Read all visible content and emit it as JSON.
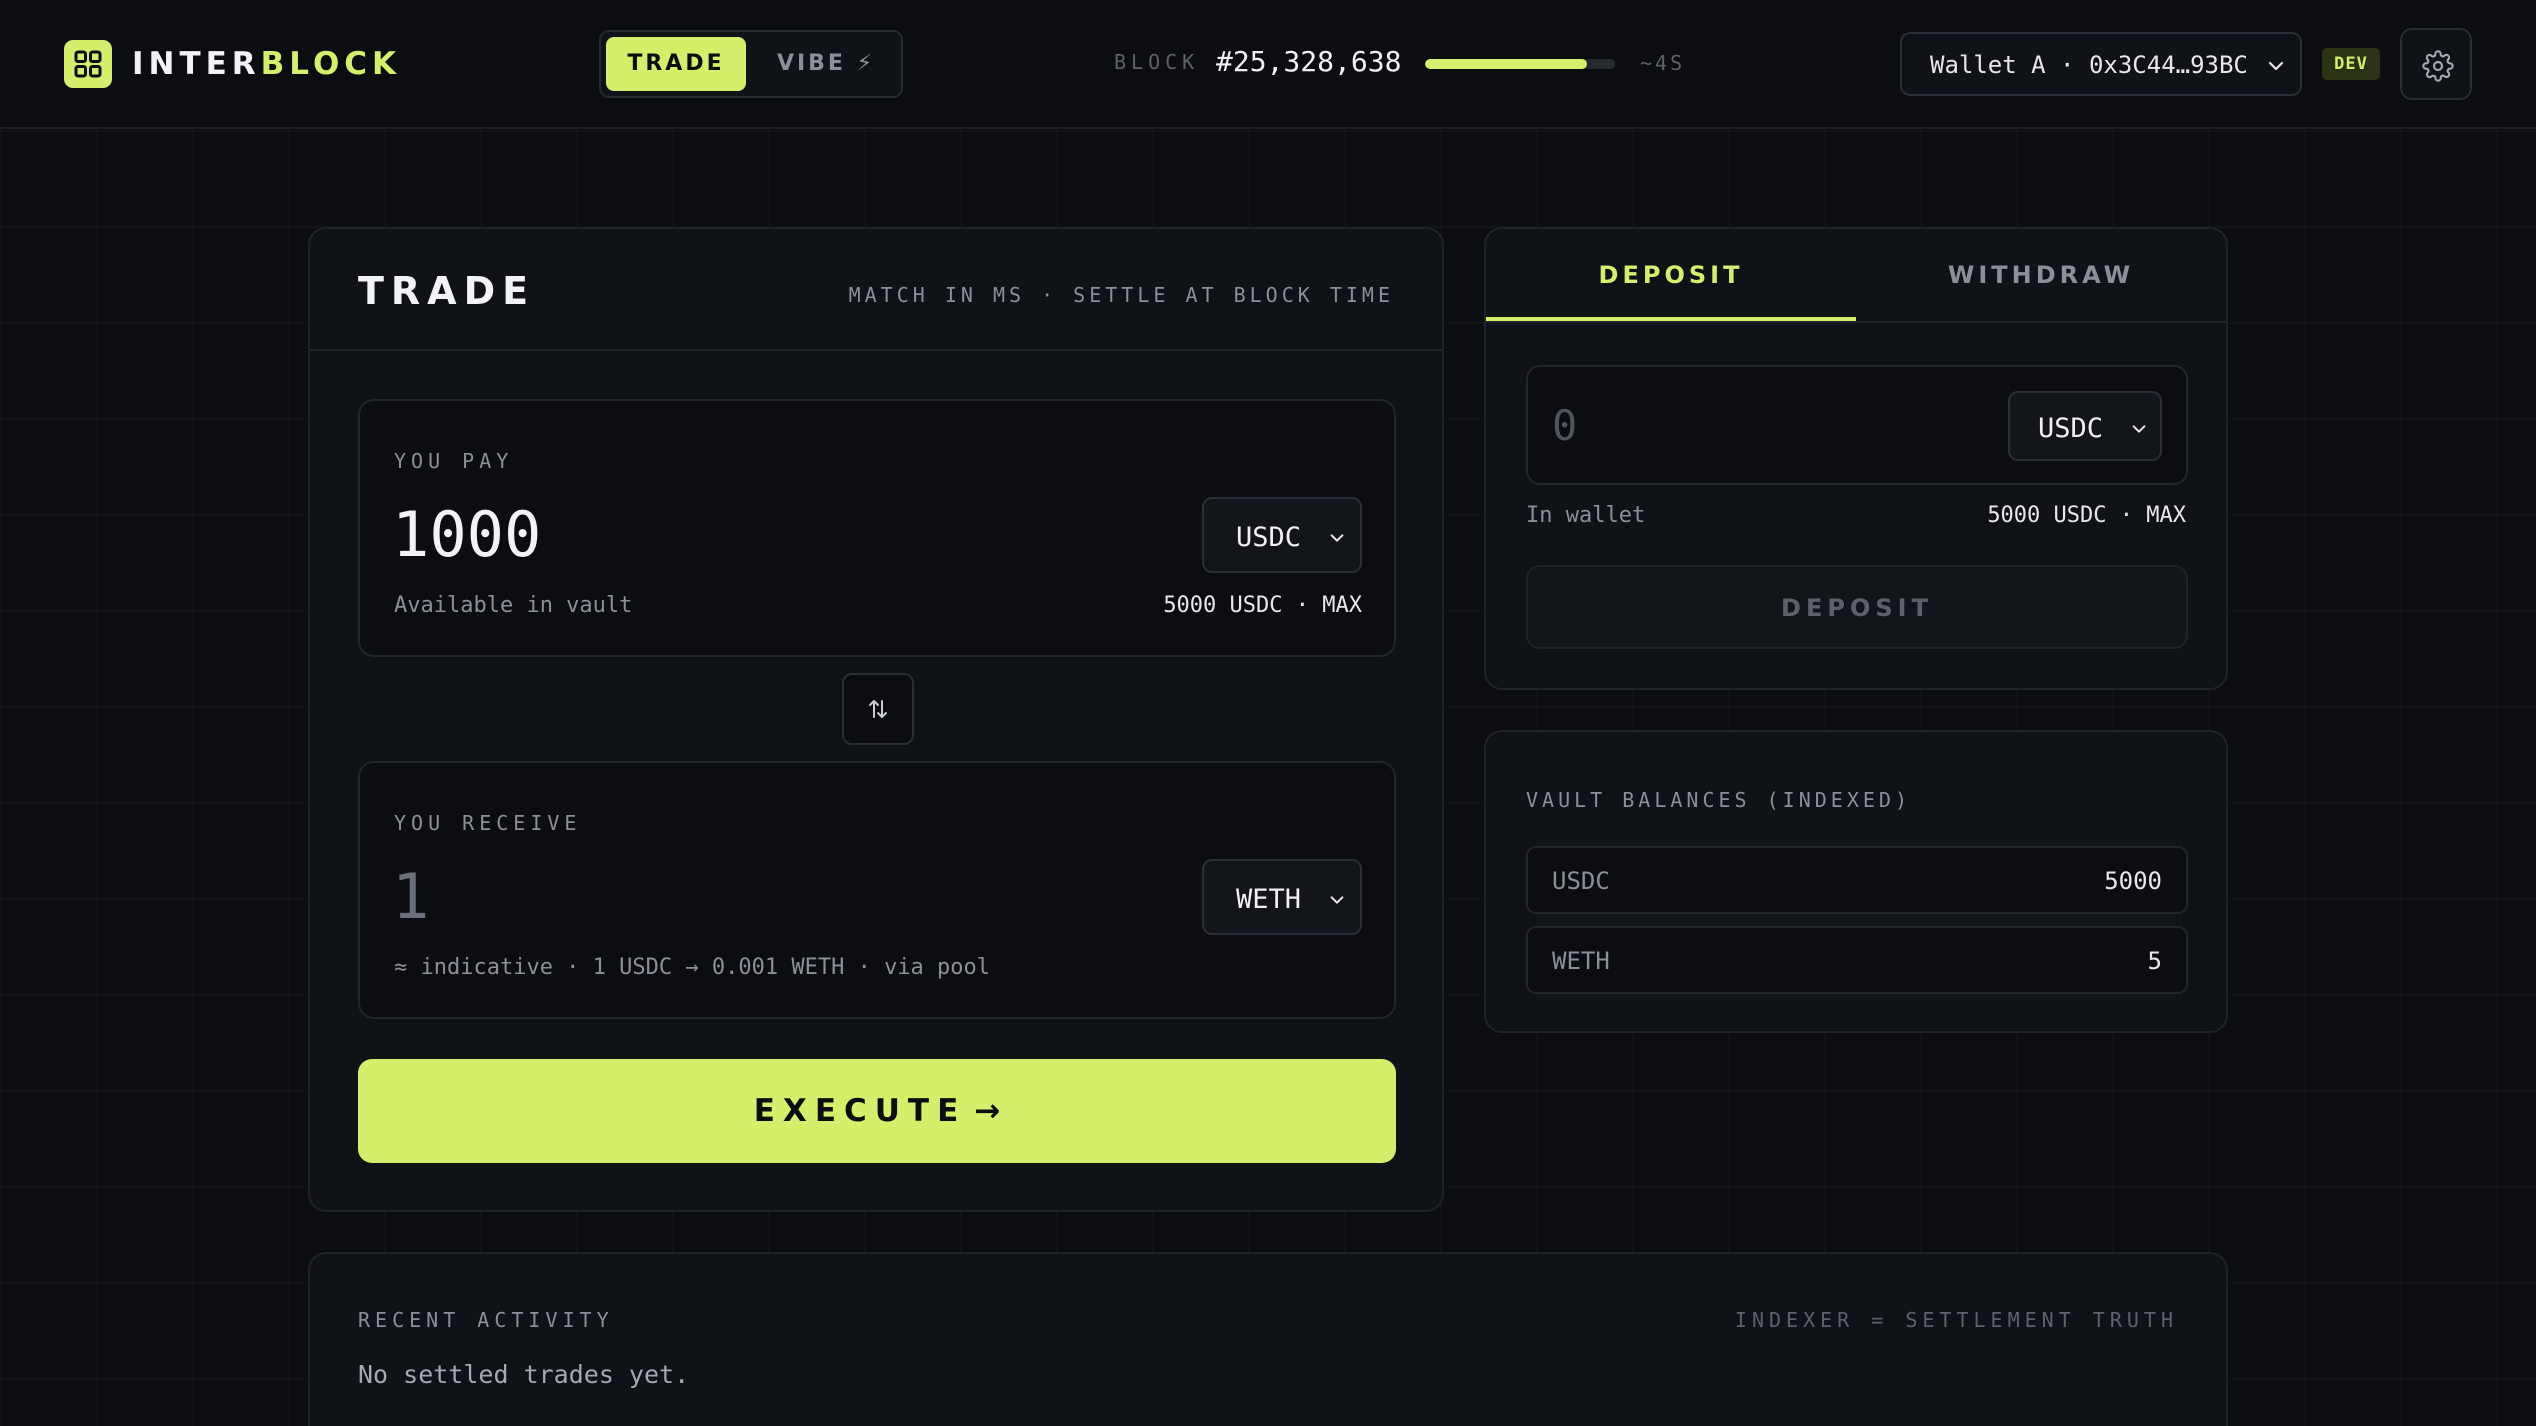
{
  "header": {
    "brand_part1": "INTER",
    "brand_part2": "BLOCK",
    "modes": [
      {
        "label": "TRADE",
        "active": true
      },
      {
        "label": "VIBE ⚡",
        "active": false
      }
    ],
    "block_label": "BLOCK",
    "block_number": "#25,328,638",
    "block_progress": 0.85,
    "block_eta": "~4S",
    "wallet": "Wallet A · 0x3C44…93BC",
    "env_badge": "DEV",
    "icons": {
      "logo": "grid-logo-icon",
      "settings": "gear-icon",
      "chevron": "chevron-down-icon"
    }
  },
  "trade": {
    "title": "TRADE",
    "subtitle": "MATCH IN MS · SETTLE AT BLOCK TIME",
    "pay": {
      "label": "YOU PAY",
      "amount": "1000",
      "token": "USDC",
      "foot_left": "Available in vault",
      "foot_right": "5000 USDC · MAX"
    },
    "receive": {
      "label": "YOU RECEIVE",
      "amount": "1",
      "token": "WETH",
      "foot_left": "≈ indicative · 1 USDC → 0.001 WETH · via pool"
    },
    "execute_label": "EXECUTE",
    "execute_arrow": "→"
  },
  "funding": {
    "tabs": [
      {
        "label": "DEPOSIT",
        "active": true
      },
      {
        "label": "WITHDRAW",
        "active": false
      }
    ],
    "amount_placeholder": "0",
    "token": "USDC",
    "wallet_label": "In wallet",
    "wallet_value": "5000 USDC · MAX",
    "button_label": "DEPOSIT"
  },
  "vault": {
    "title": "VAULT BALANCES (INDEXED)",
    "rows": [
      {
        "token": "USDC",
        "amount": "5000"
      },
      {
        "token": "WETH",
        "amount": "5"
      }
    ]
  },
  "activity": {
    "title": "RECENT ACTIVITY",
    "note": "INDEXER = SETTLEMENT TRUTH",
    "empty": "No settled trades yet."
  },
  "colors": {
    "accent": "#d4f06b",
    "background": "#0b0d11",
    "card": "#0f1216"
  }
}
